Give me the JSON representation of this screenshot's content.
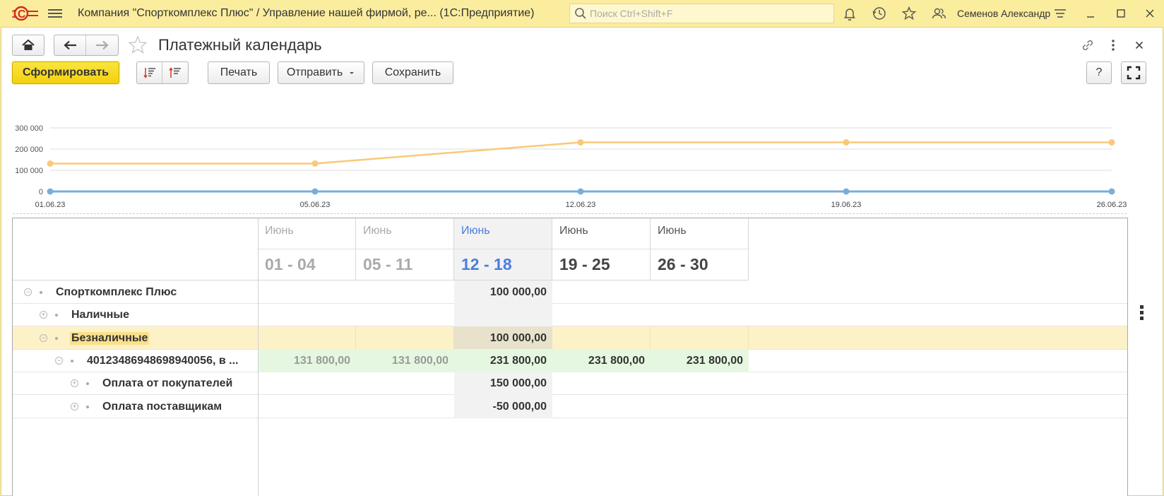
{
  "app": {
    "logo_text": "1С",
    "title": "Компания \"Спорткомплекс Плюс\" / Управление нашей фирмой, ре...  (1С:Предприятие)",
    "search_placeholder": "Поиск Ctrl+Shift+F",
    "user": "Семенов Александр"
  },
  "form": {
    "title": "Платежный календарь"
  },
  "toolbar": {
    "generate": "Сформировать",
    "print": "Печать",
    "send": "Отправить",
    "save": "Сохранить",
    "help": "?"
  },
  "colors": {
    "line_balance": "#f9c979",
    "line_zero": "#7aaed9",
    "current_period": "#4a7de0",
    "highlight_row": "#fdf1c8",
    "green_row": "#e6f7e1"
  },
  "chart_data": {
    "type": "line",
    "x": [
      "01.06.23",
      "05.06.23",
      "12.06.23",
      "19.06.23",
      "26.06.23"
    ],
    "ylim": [
      0,
      300000
    ],
    "yticks": [
      "300 000",
      "200 000",
      "100 000",
      "0"
    ],
    "ytick_values": [
      300000,
      200000,
      100000,
      0
    ],
    "grid": true,
    "series": [
      {
        "values": [
          131800,
          131800,
          231800,
          231800,
          231800
        ],
        "color": "#f9c979"
      },
      {
        "values": [
          0,
          0,
          0,
          0,
          0
        ],
        "color": "#7aaed9"
      }
    ]
  },
  "table": {
    "periods": [
      {
        "month": "Июнь",
        "range": "01 - 04",
        "style": "grey"
      },
      {
        "month": "Июнь",
        "range": "05 - 11",
        "style": "grey"
      },
      {
        "month": "Июнь",
        "range": "12 - 18",
        "style": "cur"
      },
      {
        "month": "Июнь",
        "range": "19 - 25",
        "style": "dark"
      },
      {
        "month": "Июнь",
        "range": "26 - 30",
        "style": "dark"
      }
    ],
    "rows": [
      {
        "label": "Спорткомплекс Плюс",
        "level": 0,
        "expander": "−",
        "values": [
          "",
          "",
          "100 000,00",
          "",
          ""
        ]
      },
      {
        "label": "Наличные",
        "level": 1,
        "expander": "+",
        "values": [
          "",
          "",
          "",
          "",
          ""
        ]
      },
      {
        "label": "Безналичные",
        "level": 1,
        "expander": "−",
        "values": [
          "",
          "",
          "100 000,00",
          "",
          ""
        ]
      },
      {
        "label": "40123486948698940056, в ...",
        "level": 2,
        "expander": "−",
        "values": [
          "131 800,00",
          "131 800,00",
          "231 800,00",
          "231 800,00",
          "231 800,00"
        ]
      },
      {
        "label": "Оплата от покупателей",
        "level": 3,
        "expander": "+",
        "values": [
          "",
          "",
          "150 000,00",
          "",
          ""
        ]
      },
      {
        "label": "Оплата поставщикам",
        "level": 3,
        "expander": "+",
        "values": [
          "",
          "",
          "-50 000,00",
          "",
          ""
        ]
      }
    ]
  }
}
